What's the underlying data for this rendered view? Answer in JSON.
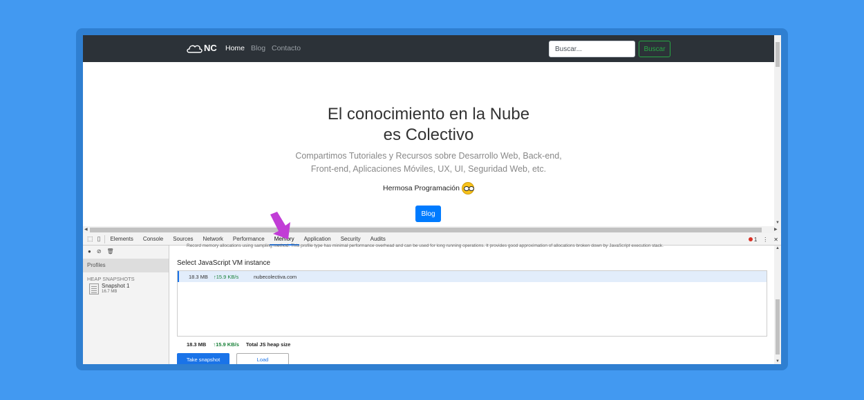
{
  "site": {
    "brand": "NC",
    "nav": [
      "Home",
      "Blog",
      "Contacto"
    ],
    "search_placeholder": "Buscar...",
    "search_button": "Buscar",
    "hero_title_line1": "El conocimiento en la Nube",
    "hero_title_line2": "es Colectivo",
    "hero_sub_line1": "Compartimos Tutoriales y Recursos sobre Desarrollo Web, Back-end,",
    "hero_sub_line2": "Front-end, Aplicaciones Móviles, UX, UI, Seguridad Web, etc.",
    "tagline": "Hermosa Programación",
    "blog_button": "Blog"
  },
  "devtools": {
    "tabs": [
      "Elements",
      "Console",
      "Sources",
      "Network",
      "Performance",
      "Memory",
      "Application",
      "Security",
      "Audits"
    ],
    "active_tab": "Memory",
    "error_count": "1",
    "sidebar": {
      "profiles_label": "Profiles",
      "heap_label": "HEAP SNAPSHOTS",
      "snapshot_name": "Snapshot 1",
      "snapshot_size": "16.7 MB"
    },
    "description": "Record memory allocations using sampling method. This profile type has minimal performance overhead and can be used for long running operations. It provides good approximation of allocations broken down by JavaScript execution stack.",
    "vm_title": "Select JavaScript VM instance",
    "vm_row": {
      "size": "18.3 MB",
      "rate": "↑15.9 KB/s",
      "host": "nubecolectiva.com"
    },
    "totals": {
      "size": "18.3 MB",
      "rate": "↑15.9 KB/s",
      "label": "Total JS heap size"
    },
    "take_button": "Take snapshot",
    "load_button": "Load"
  },
  "colors": {
    "background": "#4299f1",
    "navbar": "#2c3238",
    "primary": "#007bff",
    "success": "#28a745",
    "annotation_arrow": "#c13dd6"
  }
}
